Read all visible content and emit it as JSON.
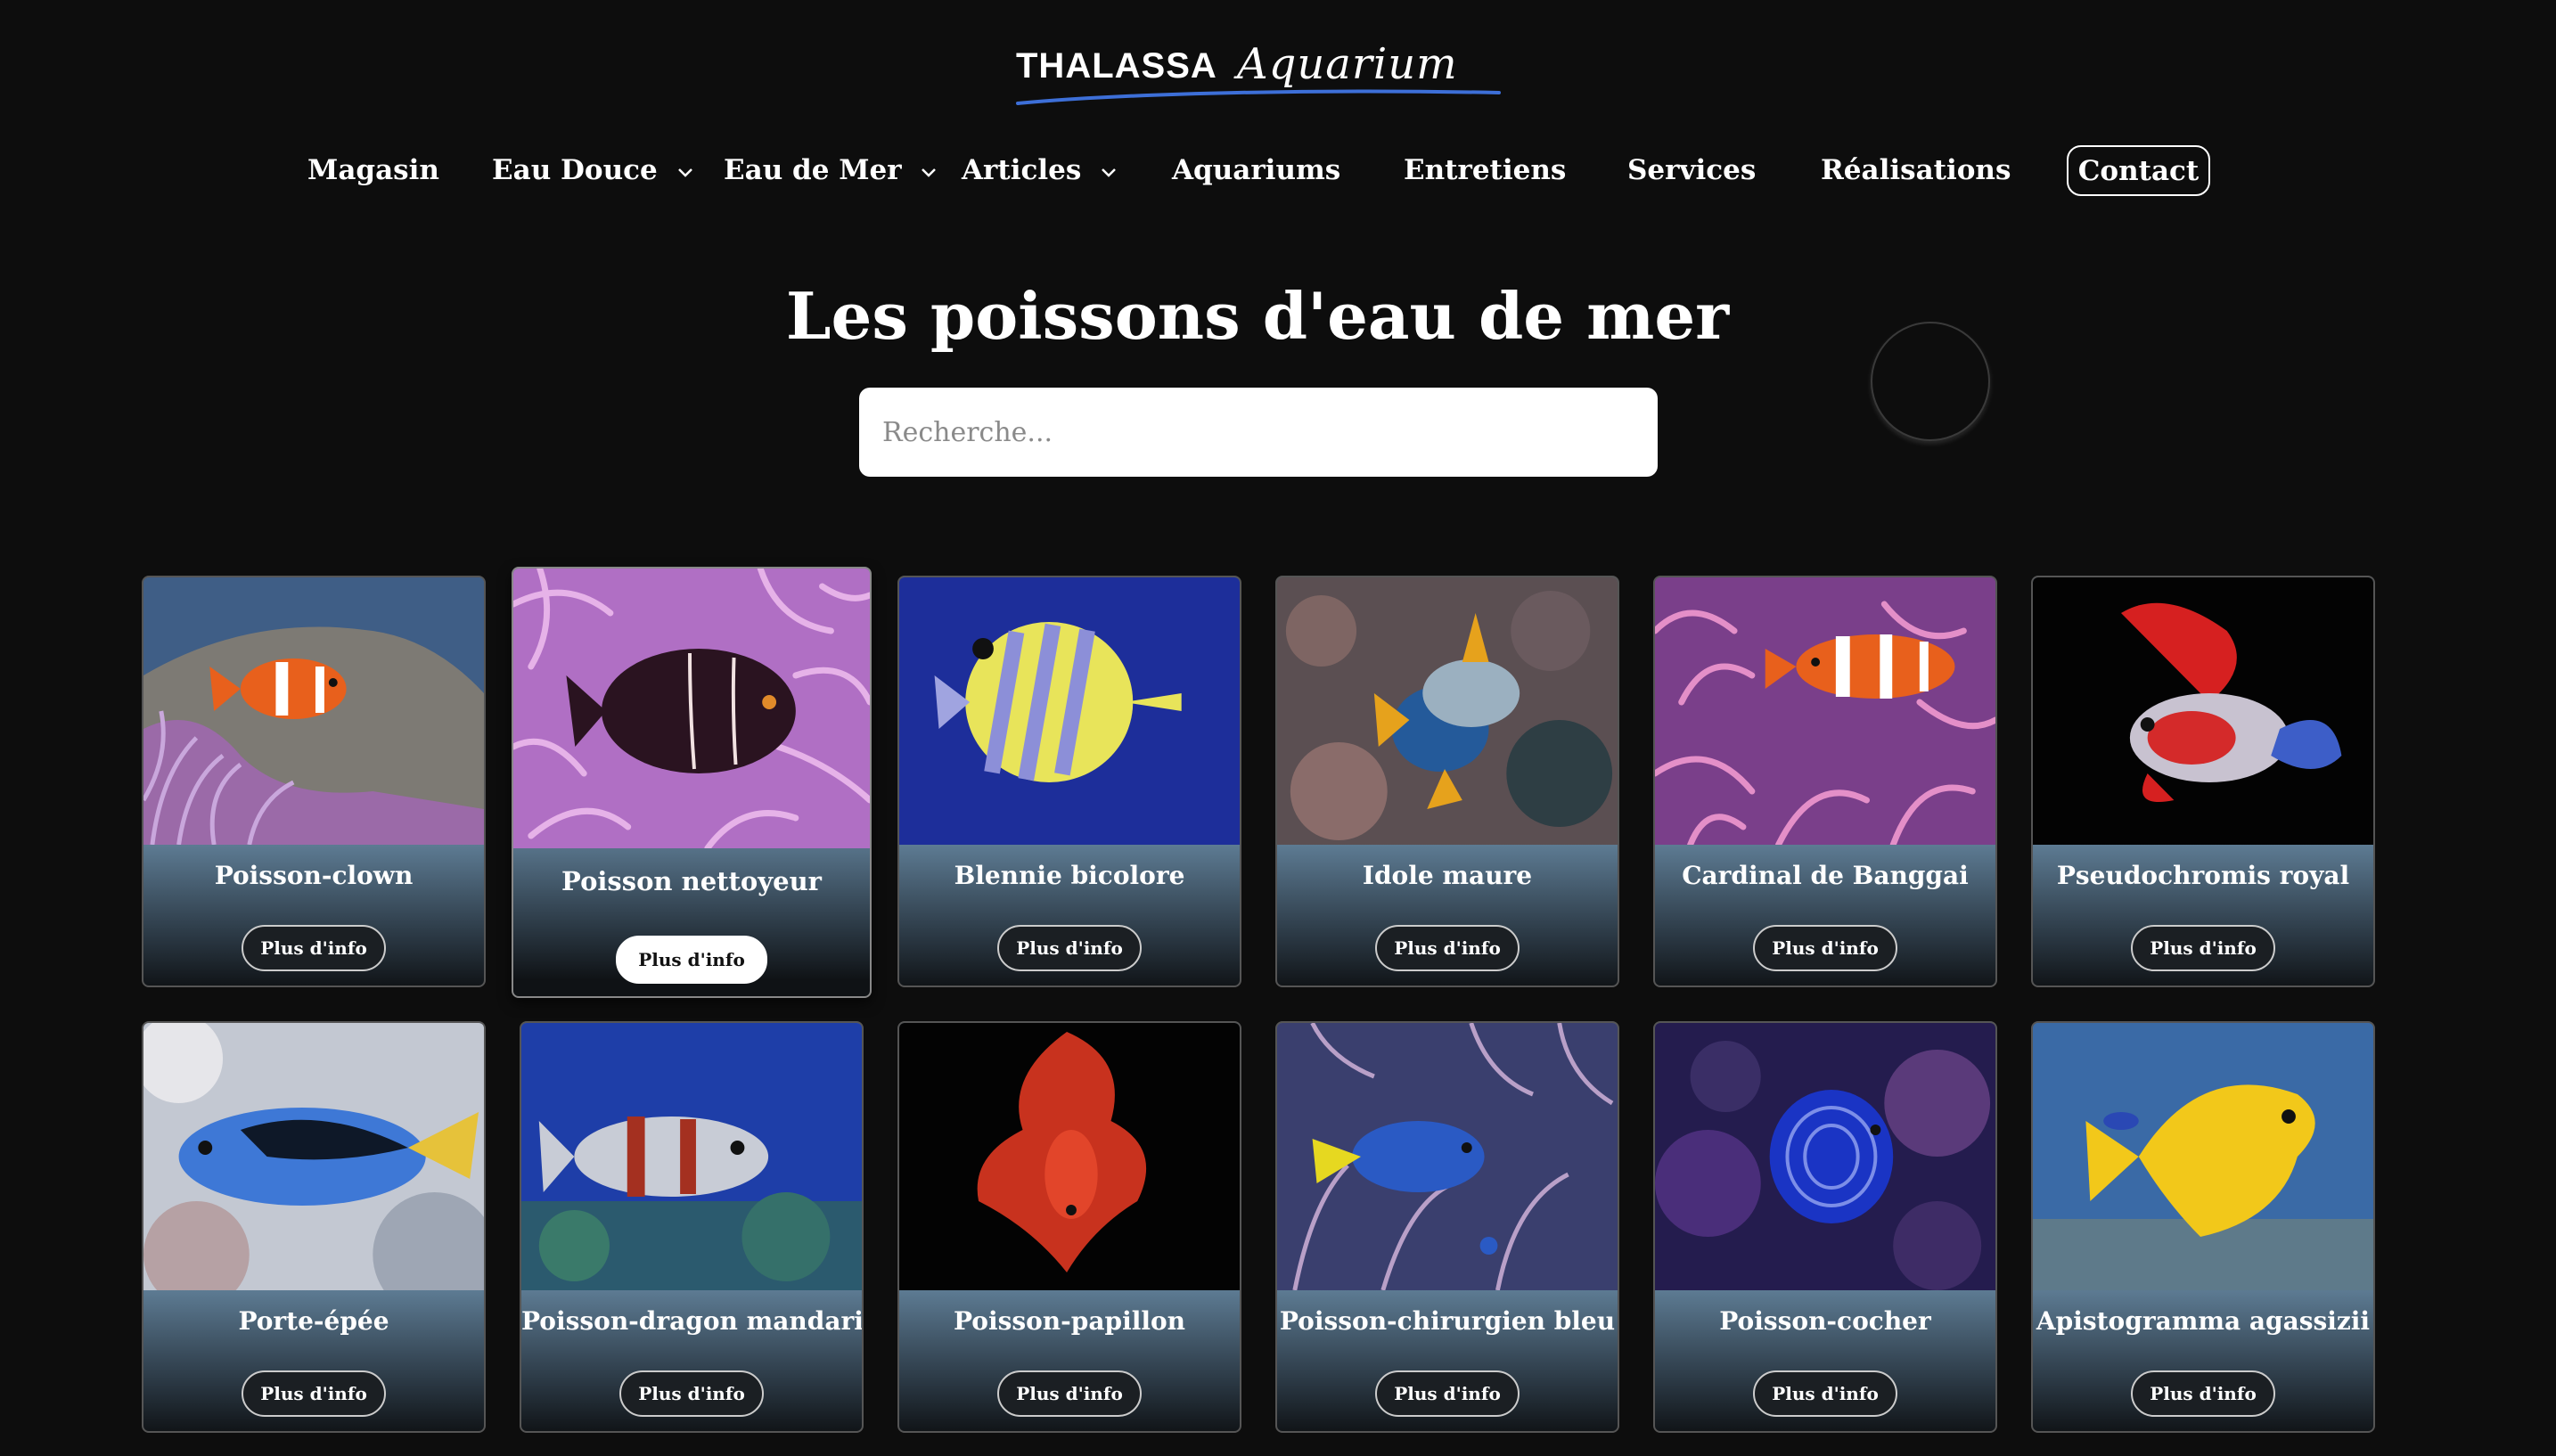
{
  "brand": {
    "main": "THALASSA",
    "script": "Aquarium"
  },
  "nav": {
    "items": [
      {
        "label": "Magasin",
        "dropdown": false
      },
      {
        "label": "Eau Douce",
        "dropdown": true
      },
      {
        "label": "Eau de Mer",
        "dropdown": true
      },
      {
        "label": "Articles",
        "dropdown": true
      },
      {
        "label": "Aquariums",
        "dropdown": false
      },
      {
        "label": "Entretiens",
        "dropdown": false
      },
      {
        "label": "Services",
        "dropdown": false
      },
      {
        "label": "Réalisations",
        "dropdown": false
      }
    ],
    "contact": "Contact"
  },
  "title": "Les poissons d'eau de mer",
  "search": {
    "placeholder": "Recherche...",
    "value": ""
  },
  "button_label": "Plus d'info",
  "fish": [
    {
      "name": "Poisson-clown",
      "featured": false
    },
    {
      "name": "Poisson nettoyeur",
      "featured": true
    },
    {
      "name": "Blennie bicolore",
      "featured": false
    },
    {
      "name": "Idole maure",
      "featured": false
    },
    {
      "name": "Cardinal de Banggai",
      "featured": false
    },
    {
      "name": "Pseudochromis royal",
      "featured": false
    },
    {
      "name": "Porte-épée",
      "featured": false
    },
    {
      "name": "Poisson-dragon mandarin",
      "featured": false
    },
    {
      "name": "Poisson-papillon",
      "featured": false
    },
    {
      "name": "Poisson-chirurgien bleu",
      "featured": false
    },
    {
      "name": "Poisson-cocher",
      "featured": false
    },
    {
      "name": "Apistogramma agassizii",
      "featured": false
    }
  ],
  "colors": {
    "background": "#0d0d0d",
    "card_top": "#5d7b93",
    "brand_accent": "#3d6fd8"
  }
}
